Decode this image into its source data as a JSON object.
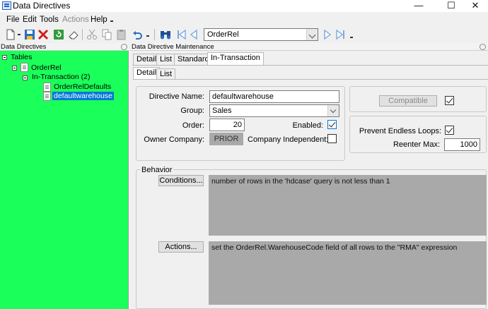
{
  "window": {
    "title": "Data Directives",
    "controls": {
      "minimize": "—",
      "maximize": "☐",
      "close": "✕"
    }
  },
  "menu": [
    {
      "label": "File",
      "enabled": true
    },
    {
      "label": "Edit",
      "enabled": true
    },
    {
      "label": "Tools",
      "enabled": true
    },
    {
      "label": "Actions",
      "enabled": false
    },
    {
      "label": "Help",
      "enabled": true
    }
  ],
  "toolbar": {
    "icons": [
      "new-document-icon",
      "save-icon",
      "delete-icon",
      "refresh-icon",
      "eraser-icon",
      "cut-icon",
      "copy-icon",
      "paste-icon",
      "undo-icon",
      "binoculars-icon",
      "first-record-icon",
      "previous-record-icon",
      "next-record-icon",
      "last-record-icon"
    ],
    "record_combo": {
      "value": "OrderRel"
    }
  },
  "left_pane": {
    "title": "Data Directives",
    "tree": {
      "root": "Tables",
      "table": "OrderRel",
      "group": "In-Transaction (2)",
      "items": [
        "OrderRelDefaults",
        "defaultwarehouse"
      ],
      "selected": "defaultwarehouse"
    }
  },
  "right_pane": {
    "title": "Data Directive Maintenance",
    "main_tabs": [
      "Detail",
      "List",
      "Standard",
      "In-Transaction"
    ],
    "active_main_tab": "In-Transaction",
    "sub_tabs": [
      "Detail",
      "List"
    ],
    "active_sub_tab": "Detail",
    "form": {
      "directive_name_label": "Directive Name:",
      "directive_name": "defaultwarehouse",
      "group_label": "Group:",
      "group": "Sales",
      "order_label": "Order:",
      "order": "20",
      "enabled_label": "Enabled:",
      "enabled": true,
      "owner_company_label": "Owner Company:",
      "owner_company": "PRIOR",
      "company_independent_label": "Company Independent:",
      "company_independent": false
    },
    "side": {
      "compatible_button": "Compatible",
      "compatible_checked": true,
      "prevent_loops_label": "Prevent Endless Loops:",
      "prevent_loops": true,
      "reenter_max_label": "Reenter Max:",
      "reenter_max": "1000"
    },
    "behavior": {
      "title": "Behavior",
      "conditions_button": "Conditions...",
      "conditions_text": "number of rows in the 'hdcase' query is not less than 1",
      "actions_button": "Actions...",
      "actions_text": "set the OrderRel.WarehouseCode field of all rows to the \"RMA\" expression"
    }
  }
}
